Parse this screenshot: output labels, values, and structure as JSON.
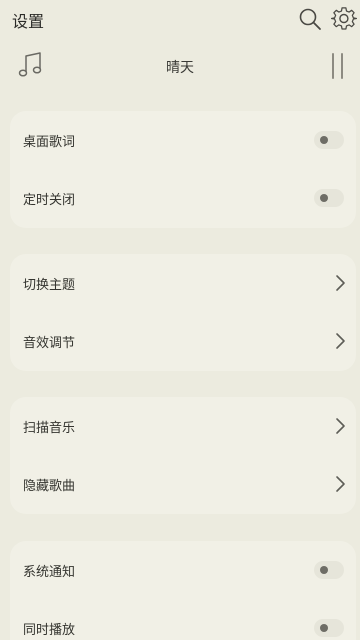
{
  "header": {
    "title": "设置"
  },
  "now_playing": {
    "title": "晴天"
  },
  "groups": [
    {
      "items": [
        {
          "label": "桌面歌词",
          "control": "toggle",
          "on": false
        },
        {
          "label": "定时关闭",
          "control": "toggle",
          "on": false
        }
      ]
    },
    {
      "items": [
        {
          "label": "切换主题",
          "control": "chevron"
        },
        {
          "label": "音效调节",
          "control": "chevron"
        }
      ]
    },
    {
      "items": [
        {
          "label": "扫描音乐",
          "control": "chevron"
        },
        {
          "label": "隐藏歌曲",
          "control": "chevron"
        }
      ]
    },
    {
      "items": [
        {
          "label": "系统通知",
          "control": "toggle",
          "on": false
        },
        {
          "label": "同时播放",
          "control": "toggle",
          "on": false
        }
      ]
    }
  ],
  "icons": {
    "search": "search-icon",
    "settings": "gear-icon",
    "music": "music-note-icon",
    "pause": "pause-icon",
    "chevron": "chevron-right-icon"
  },
  "colors": {
    "background": "#ecebdf",
    "card": "#f1f0e6",
    "text": "#34342f",
    "icon": "#5e5d57"
  }
}
